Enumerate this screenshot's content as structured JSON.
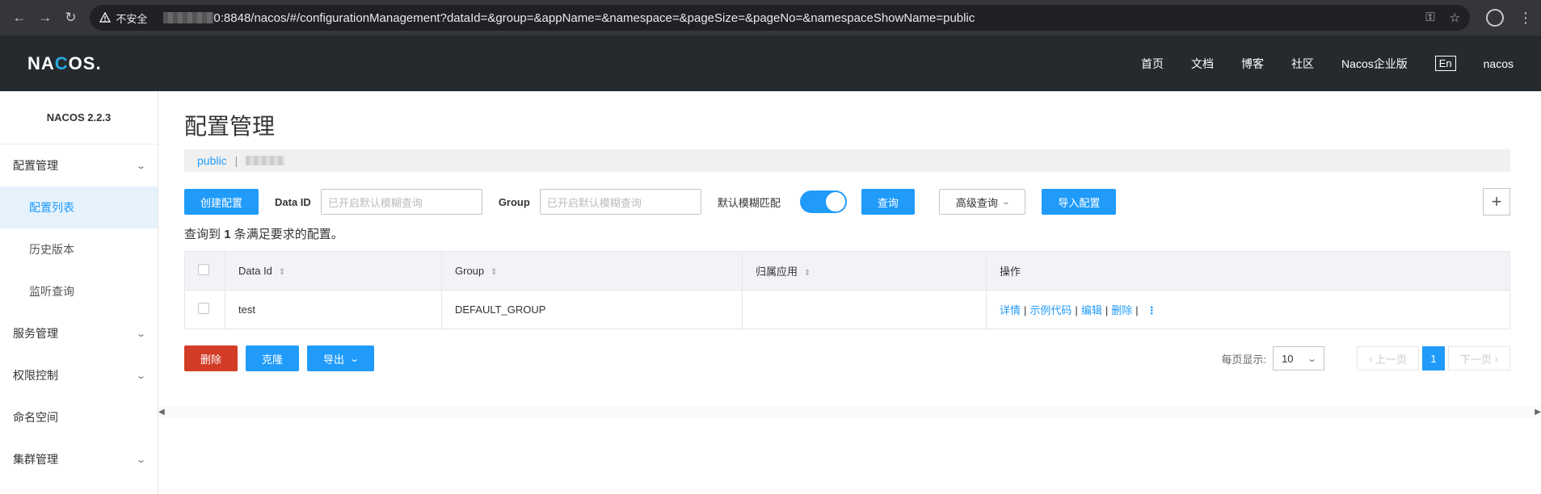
{
  "browser": {
    "security_label": "不安全",
    "url": "0:8848/nacos/#/configurationManagement?dataId=&group=&appName=&namespace=&pageSize=&pageNo=&namespaceShowName=public"
  },
  "header": {
    "logo": "NACOS.",
    "nav": [
      "首页",
      "文档",
      "博客",
      "社区",
      "Nacos企业版"
    ],
    "lang": "En",
    "user": "nacos"
  },
  "sidebar": {
    "version": "NACOS 2.2.3",
    "config_group": "配置管理",
    "config_items": [
      "配置列表",
      "历史版本",
      "监听查询"
    ],
    "service_group": "服务管理",
    "auth_group": "权限控制",
    "namespace": "命名空间",
    "cluster_group": "集群管理"
  },
  "main": {
    "title": "配置管理",
    "namespace_active": "public",
    "namespace_sep": "|",
    "create_btn": "创建配置",
    "dataid_label": "Data ID",
    "dataid_placeholder": "已开启默认模糊查询",
    "group_label": "Group",
    "group_placeholder": "已开启默认模糊查询",
    "fuzzy_label": "默认模糊匹配",
    "fuzzy_enabled": true,
    "query_btn": "查询",
    "advanced_btn": "高级查询",
    "import_btn": "导入配置",
    "plus": "+",
    "result_prefix": "查询到",
    "result_count": "1",
    "result_suffix": "条满足要求的配置。"
  },
  "table": {
    "columns": [
      "Data Id",
      "Group",
      "归属应用",
      "操作"
    ],
    "rows": [
      {
        "data_id": "test",
        "group": "DEFAULT_GROUP",
        "app": ""
      }
    ],
    "ops": [
      "详情",
      "示例代码",
      "编辑",
      "删除"
    ]
  },
  "bottom": {
    "delete_btn": "删除",
    "clone_btn": "克隆",
    "export_btn": "导出",
    "page_size_label": "每页显示:",
    "page_size": "10",
    "prev": "上一页",
    "next": "下一页",
    "current_page": "1"
  },
  "colors": {
    "primary": "#209bfa",
    "danger": "#d23c26",
    "header_bg": "#252a2f"
  }
}
